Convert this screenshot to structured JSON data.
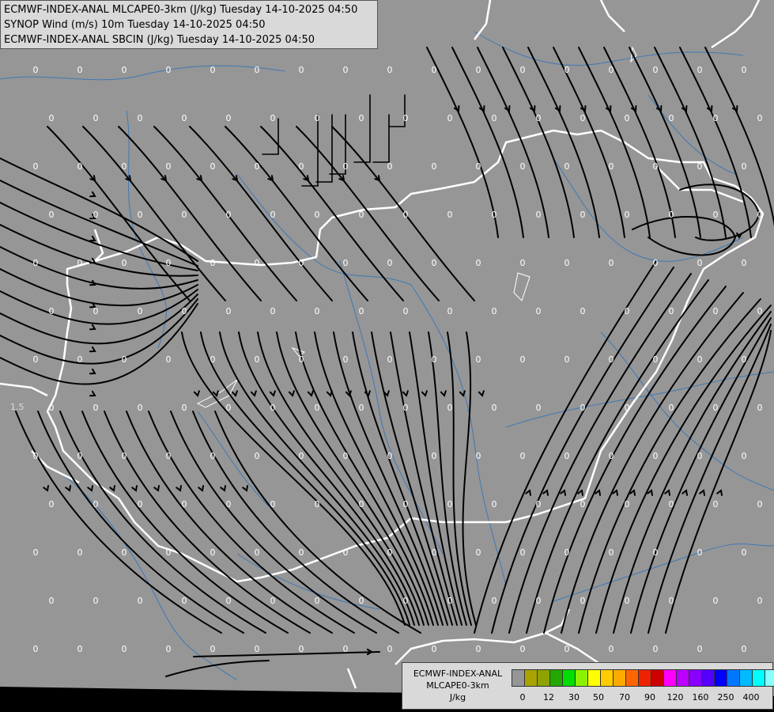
{
  "titles": [
    "ECMWF-INDEX-ANAL MLCAPE0-3km (J/kg) Tuesday 14-10-2025 04:50",
    "SYNOP Wind (m/s) 10m Tuesday 14-10-2025 04:50",
    "ECMWF-INDEX-ANAL SBCIN (J/kg) Tuesday 14-10-2025 04:50"
  ],
  "legend": {
    "name": [
      "ECMWF-INDEX-ANAL",
      "MLCAPE0-3km",
      "J/kg"
    ],
    "colors": [
      "#969696",
      "#a9a300",
      "#8ea300",
      "#23a800",
      "#00dd00",
      "#8df000",
      "#ffff00",
      "#ffcc00",
      "#ffaa00",
      "#ff6600",
      "#ee2200",
      "#cc0000",
      "#ff00ff",
      "#bb00ff",
      "#8800ff",
      "#5500ff",
      "#0000ff",
      "#0077ff",
      "#00bbff",
      "#00ffff",
      "#88ffff",
      "#ffffff"
    ],
    "ticks": [
      "0",
      "12",
      "30",
      "50",
      "70",
      "90",
      "120",
      "160",
      "250",
      "400"
    ]
  },
  "station_values": {
    "default": "0",
    "special": "1.5"
  },
  "colors": {
    "background": "#969696",
    "border": "#ffffff",
    "river": "#3f79b5",
    "streamline": "#000000",
    "label": "#ffffff"
  }
}
